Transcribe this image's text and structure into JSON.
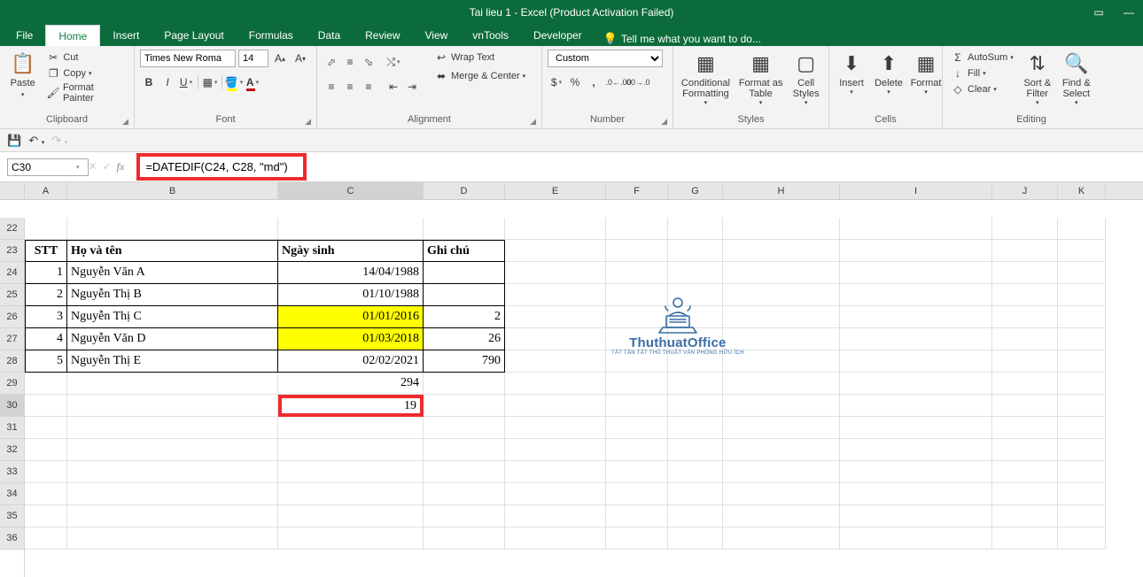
{
  "title": "Tai lieu 1 - Excel (Product Activation Failed)",
  "tabs": [
    "File",
    "Home",
    "Insert",
    "Page Layout",
    "Formulas",
    "Data",
    "Review",
    "View",
    "vnTools",
    "Developer"
  ],
  "tell_me": "Tell me what you want to do...",
  "clipboard": {
    "paste": "Paste",
    "cut": "Cut",
    "copy": "Copy",
    "format_painter": "Format Painter",
    "label": "Clipboard"
  },
  "font": {
    "family": "Times New Roma",
    "size": "14",
    "label": "Font"
  },
  "alignment": {
    "wrap": "Wrap Text",
    "merge": "Merge & Center",
    "label": "Alignment"
  },
  "number": {
    "format": "Custom",
    "label": "Number"
  },
  "styles": {
    "cond": "Conditional\nFormatting",
    "table": "Format as\nTable",
    "cell": "Cell\nStyles",
    "label": "Styles"
  },
  "cells_grp": {
    "insert": "Insert",
    "delete": "Delete",
    "format": "Format",
    "label": "Cells"
  },
  "editing": {
    "autosum": "AutoSum",
    "fill": "Fill",
    "clear": "Clear",
    "sort": "Sort &\nFilter",
    "find": "Find &\nSelect",
    "label": "Editing"
  },
  "name_box": "C30",
  "formula": "=DATEDIF(C24, C28, \"md\")",
  "columns": [
    "A",
    "B",
    "C",
    "D",
    "E",
    "F",
    "G",
    "H",
    "I",
    "J",
    "K"
  ],
  "rows": [
    "22",
    "23",
    "24",
    "25",
    "26",
    "27",
    "28",
    "29",
    "30",
    "31",
    "32",
    "33",
    "34",
    "35",
    "36"
  ],
  "table": {
    "header": {
      "A": "STT",
      "B": "Họ và tên",
      "C": "Ngày sinh",
      "D": "Ghi chú"
    },
    "rows": [
      {
        "A": "1",
        "B": "Nguyễn Văn A",
        "C": "14/04/1988",
        "D": ""
      },
      {
        "A": "2",
        "B": "Nguyễn Thị B",
        "C": "01/10/1988",
        "D": ""
      },
      {
        "A": "3",
        "B": "Nguyễn Thị C",
        "C": "01/01/2016",
        "D": "2",
        "hl": true
      },
      {
        "A": "4",
        "B": "Nguyễn Văn D",
        "C": "01/03/2018",
        "D": "26",
        "hl": true
      },
      {
        "A": "5",
        "B": "Nguyễn Thị E",
        "C": "02/02/2021",
        "D": "790"
      }
    ],
    "c29": "294",
    "c30": "19"
  },
  "watermark": {
    "text": "ThuthuatOffice",
    "sub": "TẤT TẦN TẬT THỦ THUẬT VĂN PHÒNG HỮU ÍCH"
  }
}
